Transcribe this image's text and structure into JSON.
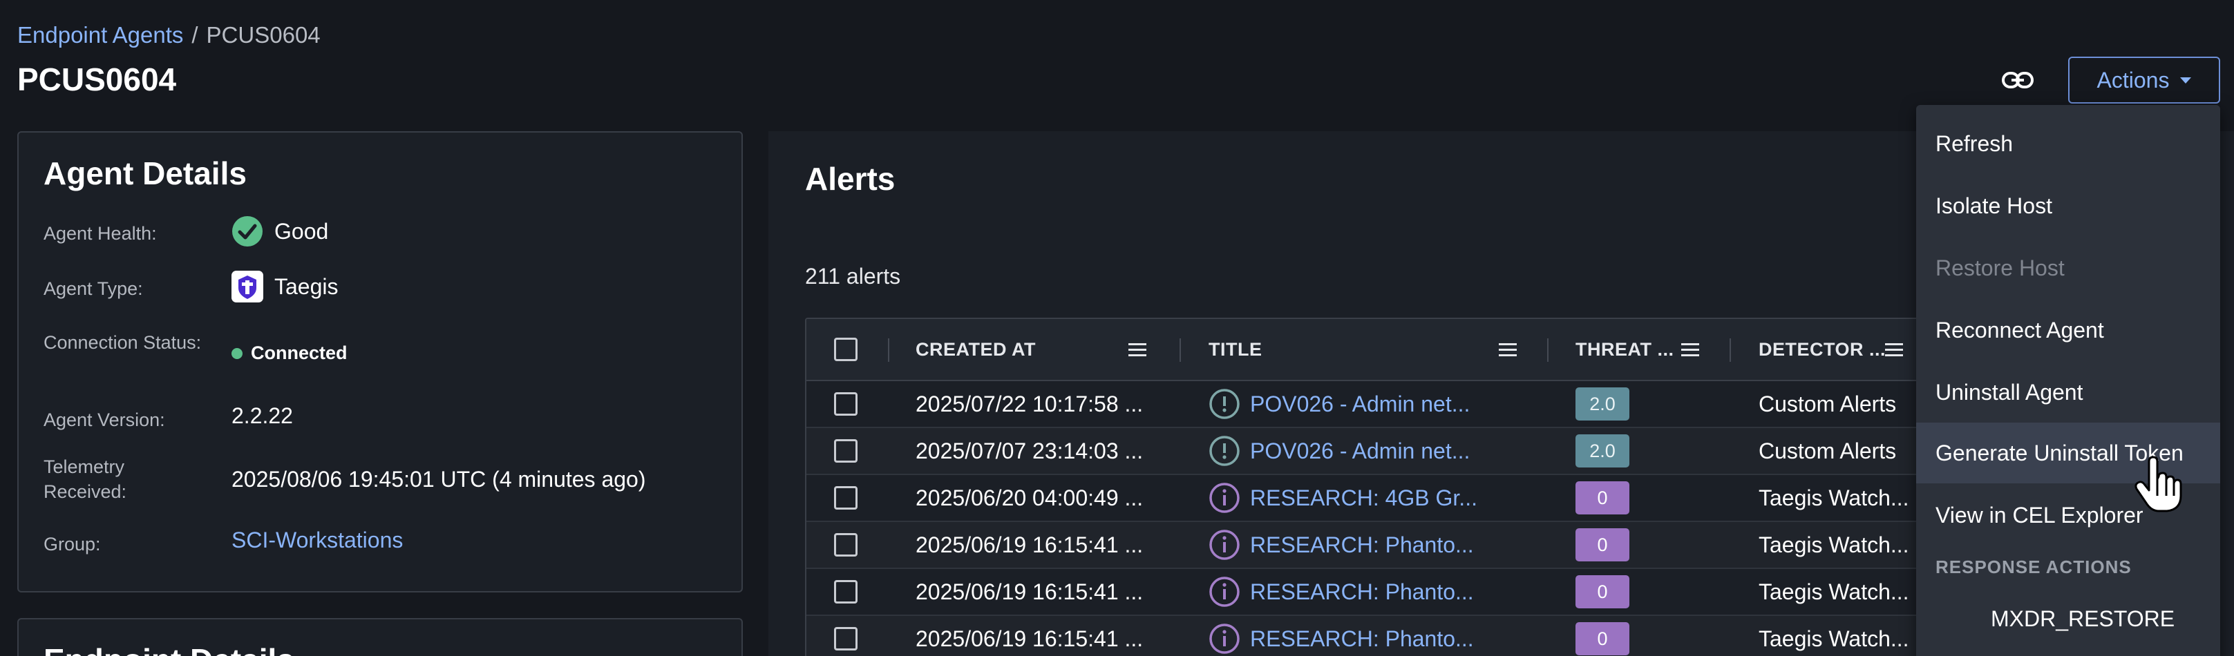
{
  "breadcrumb": {
    "parent": "Endpoint Agents",
    "separator": "/",
    "current": "PCUS0604"
  },
  "page_title": "PCUS0604",
  "header": {
    "actions_label": "Actions"
  },
  "agent_details": {
    "title": "Agent Details",
    "health_label": "Agent Health:",
    "health_value": "Good",
    "type_label": "Agent Type:",
    "type_value": "Taegis",
    "connection_label": "Connection Status:",
    "connection_value": "Connected",
    "version_label": "Agent Version:",
    "version_value": "2.2.22",
    "telemetry_label": "Telemetry Received:",
    "telemetry_value": "2025/08/06 19:45:01 UTC (4 minutes ago)",
    "group_label": "Group:",
    "group_value": "SCI-Workstations"
  },
  "endpoint_details": {
    "title": "Endpoint Details"
  },
  "alerts": {
    "title": "Alerts",
    "count": "211 alerts",
    "columns": [
      "CREATED AT",
      "TITLE",
      "THREAT ...",
      "DETECTOR ..."
    ],
    "rows": [
      {
        "created": "2025/07/22 10:17:58 ...",
        "title": "POV026 - Admin net...",
        "threat": "2.0",
        "detector": "Custom Alerts"
      },
      {
        "created": "2025/07/07 23:14:03 ...",
        "title": "POV026 - Admin net...",
        "threat": "2.0",
        "detector": "Custom Alerts"
      },
      {
        "created": "2025/06/20 04:00:49 ...",
        "title": "RESEARCH: 4GB Gr...",
        "threat": "0",
        "detector": "Taegis Watch..."
      },
      {
        "created": "2025/06/19 16:15:41 ...",
        "title": "RESEARCH: Phanto...",
        "threat": "0",
        "detector": "Taegis Watch..."
      },
      {
        "created": "2025/06/19 16:15:41 ...",
        "title": "RESEARCH: Phanto...",
        "threat": "0",
        "detector": "Taegis Watch..."
      },
      {
        "created": "2025/06/19 16:15:41 ...",
        "title": "RESEARCH: Phanto...",
        "threat": "0",
        "detector": "Taegis Watch..."
      }
    ]
  },
  "actions_menu": {
    "items": [
      "Refresh",
      "Isolate Host",
      "Restore Host",
      "Reconnect Agent",
      "Uninstall Agent",
      "Generate Uninstall Token",
      "View in CEL Explorer"
    ],
    "section_label": "RESPONSE ACTIONS",
    "response_items": [
      "MXDR_RESTORE"
    ]
  },
  "colors": {
    "accent": "#8ab4f8",
    "success": "#5cbf8b",
    "threat_teal": "#5f8d9a",
    "threat_purple": "#9a73c2",
    "background": "#15181e"
  },
  "icons": [
    "link-icon",
    "caret-down-icon",
    "check-circle-icon",
    "taegis-logo-icon",
    "status-dot-icon",
    "column-menu-icon",
    "info-icon",
    "hand-cursor-icon"
  ]
}
